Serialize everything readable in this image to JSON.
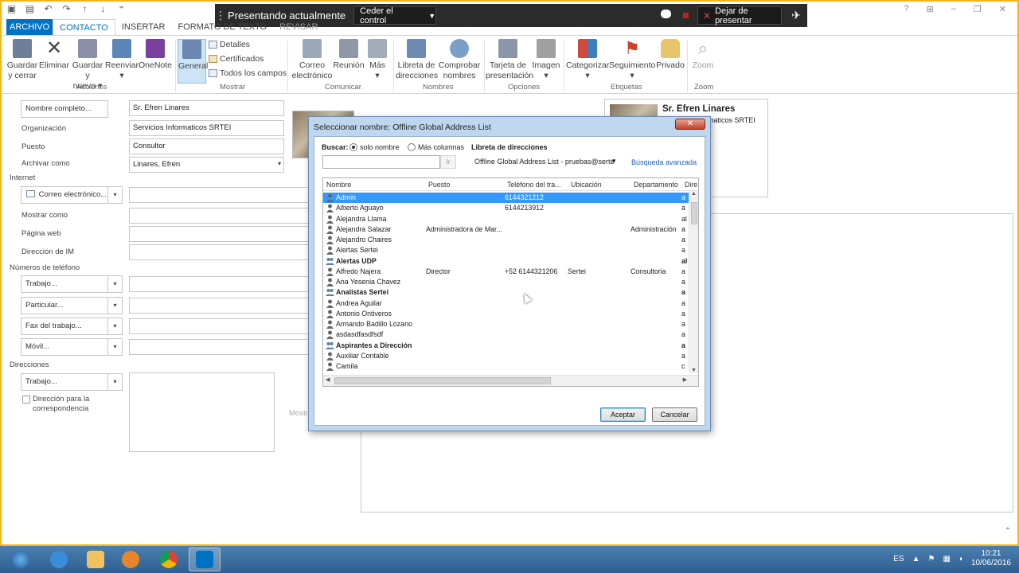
{
  "presenter": {
    "title": "Presentando actualmente",
    "control_label": "Ceder el control",
    "stop_label": "Dejar de presentar"
  },
  "tabs": [
    "ARCHIVO",
    "CONTACTO",
    "INSERTAR",
    "FORMATO DE TEXTO",
    "REVISAR"
  ],
  "ribbon": {
    "actions": [
      {
        "label": "Guardar",
        "label2": "y cerrar"
      },
      {
        "label": "Eliminar",
        "label2": ""
      },
      {
        "label": "Guardar y",
        "label2": "nuevo ▾"
      },
      {
        "label": "Reenviar",
        "label2": "▾"
      },
      {
        "label": "OneNote",
        "label2": ""
      }
    ],
    "group_acciones": "Acciones",
    "mostrar": {
      "general": "General",
      "detalles": "Detalles",
      "certificados": "Certificados",
      "todos": "Todos los campos",
      "group": "Mostrar"
    },
    "comunicar": {
      "correo": "Correo",
      "correo2": "electrónico",
      "reunion": "Reunión",
      "mas": "Más",
      "group": "Comunicar"
    },
    "nombres": {
      "libreta": "Libreta de",
      "libreta2": "direcciones",
      "comprobar": "Comprobar",
      "comprobar2": "nombres",
      "group": "Nombres"
    },
    "opciones": {
      "tarjeta": "Tarjeta de",
      "tarjeta2": "presentación",
      "imagen": "Imagen",
      "group": "Opciones"
    },
    "etiquetas": {
      "categorizar": "Categorizar",
      "seguimiento": "Seguimiento",
      "privado": "Privado",
      "group": "Etiquetas"
    },
    "zoom": {
      "label": "Zoom",
      "group": "Zoom"
    }
  },
  "form": {
    "full_name_btn": "Nombre completo...",
    "full_name": "Sr. Efren Linares",
    "org_label": "Organización",
    "org": "Servicios Informaticos SRTEI",
    "puesto_label": "Puesto",
    "puesto": "Consultor",
    "archivar_label": "Archivar como",
    "archivar": "Linares, Efren",
    "internet_label": "Internet",
    "email_btn": "Correo electrónico...",
    "mostrar_como": "Mostrar como",
    "pagina_web": "Página web",
    "direccion_im": "Dirección de IM",
    "telefonos_label": "Números de teléfono",
    "trabajo": "Trabajo...",
    "particular": "Particular...",
    "fax": "Fax del trabajo...",
    "movil": "Móvil...",
    "direcciones_label": "Direcciones",
    "dir_trabajo": "Trabajo...",
    "dir_corresp": "Dirección para la",
    "dir_corresp2": "correspondencia",
    "map_label": "Mostra"
  },
  "card": {
    "name": "Sr. Efren Linares",
    "org": "Servicios Informaticos SRTEI"
  },
  "dialog": {
    "title": "Seleccionar nombre: Offline Global Address List",
    "close": "✕",
    "buscar": "Buscar:",
    "solo_nombre": "solo nombre",
    "mas_columnas": "Más columnas",
    "libreta": "Libreta de direcciones",
    "go": "Ir",
    "address_book": "Offline Global Address List - pruebas@serte",
    "advanced": "Búsqueda avanzada",
    "columns": [
      "Nombre",
      "Puesto",
      "Teléfono del tra...",
      "Ubicación",
      "Departamento",
      "Dire"
    ],
    "rows": [
      {
        "name": "Admin",
        "puesto": "",
        "tel": "6144321212",
        "ubic": "",
        "depto": "",
        "dir": "a",
        "sel": true,
        "grp": false
      },
      {
        "name": "Alberto Aguayo",
        "puesto": "",
        "tel": "6144213912",
        "ubic": "",
        "depto": "",
        "dir": "a",
        "sel": false,
        "grp": false
      },
      {
        "name": "Alejandra Llama",
        "puesto": "",
        "tel": "",
        "ubic": "",
        "depto": "",
        "dir": "al",
        "sel": false,
        "grp": false
      },
      {
        "name": "Alejandra Salazar",
        "puesto": "Administradora de Mar...",
        "tel": "",
        "ubic": "",
        "depto": "Administración",
        "dir": "a",
        "sel": false,
        "grp": false
      },
      {
        "name": "Alejandro Chaires",
        "puesto": "",
        "tel": "",
        "ubic": "",
        "depto": "",
        "dir": "a",
        "sel": false,
        "grp": false
      },
      {
        "name": "Alertas Sertei",
        "puesto": "",
        "tel": "",
        "ubic": "",
        "depto": "",
        "dir": "a",
        "sel": false,
        "grp": false
      },
      {
        "name": "Alertas UDP",
        "puesto": "",
        "tel": "",
        "ubic": "",
        "depto": "",
        "dir": "al",
        "sel": false,
        "grp": true
      },
      {
        "name": "Alfredo Najera",
        "puesto": "Director",
        "tel": "+52 6144321206",
        "ubic": "Sertei",
        "depto": "Consultoria",
        "dir": "a",
        "sel": false,
        "grp": false
      },
      {
        "name": "Ana Yesenia Chavez",
        "puesto": "",
        "tel": "",
        "ubic": "",
        "depto": "",
        "dir": "a",
        "sel": false,
        "grp": false
      },
      {
        "name": "Analistas Sertei",
        "puesto": "",
        "tel": "",
        "ubic": "",
        "depto": "",
        "dir": "a",
        "sel": false,
        "grp": true
      },
      {
        "name": "Andrea Aguilar",
        "puesto": "",
        "tel": "",
        "ubic": "",
        "depto": "",
        "dir": "a",
        "sel": false,
        "grp": false
      },
      {
        "name": "Antonio Ontiveros",
        "puesto": "",
        "tel": "",
        "ubic": "",
        "depto": "",
        "dir": "a",
        "sel": false,
        "grp": false
      },
      {
        "name": "Armando Badillo Lozano",
        "puesto": "",
        "tel": "",
        "ubic": "",
        "depto": "",
        "dir": "a",
        "sel": false,
        "grp": false
      },
      {
        "name": "asdasdfasdfsdf",
        "puesto": "",
        "tel": "",
        "ubic": "",
        "depto": "",
        "dir": "a",
        "sel": false,
        "grp": false
      },
      {
        "name": "Aspirantes a Dirección",
        "puesto": "",
        "tel": "",
        "ubic": "",
        "depto": "",
        "dir": "a",
        "sel": false,
        "grp": true
      },
      {
        "name": "Auxiliar Contable",
        "puesto": "",
        "tel": "",
        "ubic": "",
        "depto": "",
        "dir": "a",
        "sel": false,
        "grp": false
      },
      {
        "name": "Camila",
        "puesto": "",
        "tel": "",
        "ubic": "",
        "depto": "",
        "dir": "c",
        "sel": false,
        "grp": false
      }
    ],
    "ok": "Aceptar",
    "cancel": "Cancelar"
  },
  "taskbar": {
    "lang": "ES",
    "time": "10:21",
    "date": "10/06/2016"
  }
}
